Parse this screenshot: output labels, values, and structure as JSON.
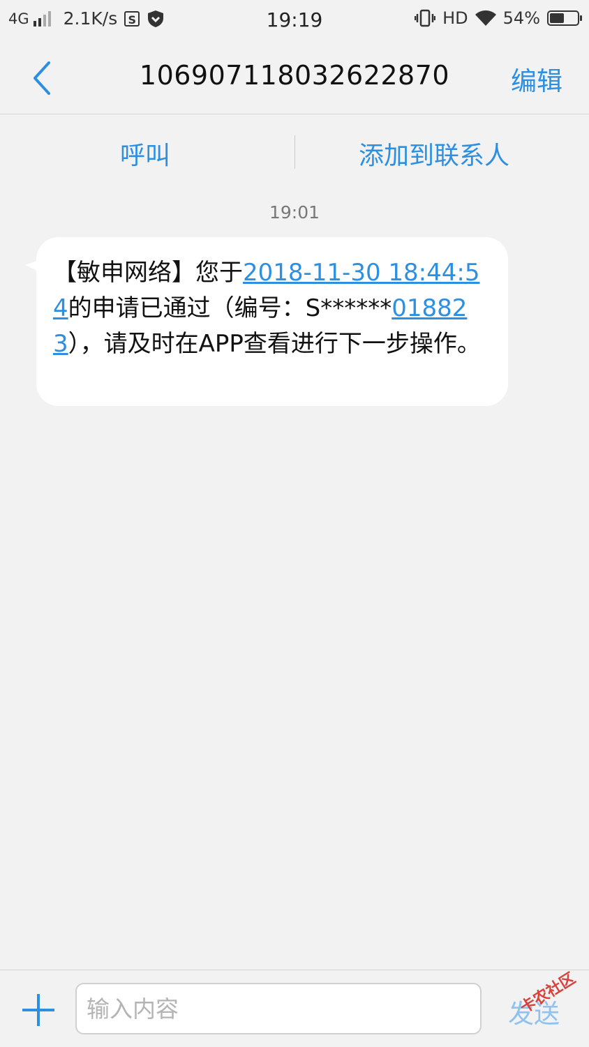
{
  "status_bar": {
    "network": "4G",
    "speed": "2.1K/s",
    "time": "19:19",
    "hd": "HD",
    "battery": "54%",
    "battery_level": 0.54,
    "icons": [
      "signal-icon",
      "s-app-icon",
      "shield-icon",
      "vibrate-icon",
      "wifi-icon",
      "battery-icon"
    ]
  },
  "header": {
    "back_icon": "back-chevron-icon",
    "title": "106907118032622870",
    "edit_label": "编辑"
  },
  "actions": {
    "call_label": "呼叫",
    "add_contact_label": "添加到联系人"
  },
  "conversation": {
    "timestamp": "19:01",
    "message": {
      "p1": "【敏申网络】您于",
      "link_datetime": "2018-11-30 18:44:54",
      "p2": "的申请已通过（编号：S******",
      "link_number": "018823",
      "p3": "），请及时在APP查看进行下一步操作。"
    }
  },
  "composer": {
    "plus_icon": "plus-icon",
    "placeholder": "输入内容",
    "value": "",
    "send_label": "发送"
  },
  "watermark": "卡农社区",
  "colors": {
    "accent": "#2d8fe0",
    "background": "#f2f2f2",
    "bubble": "#ffffff",
    "send_disabled": "#8fc2ee"
  }
}
